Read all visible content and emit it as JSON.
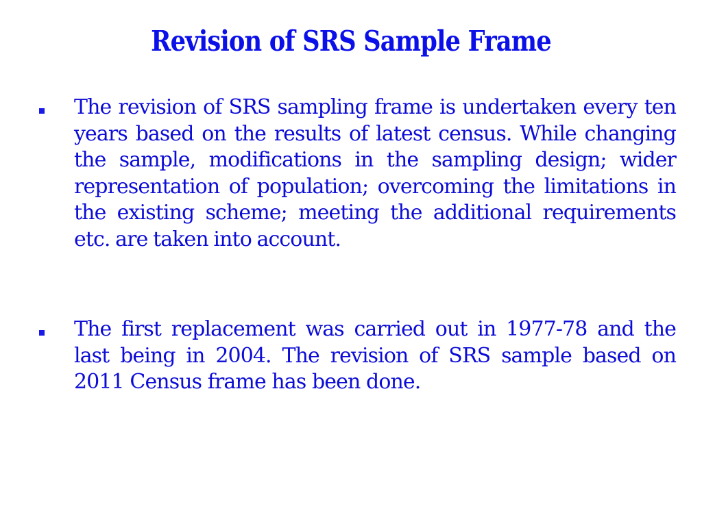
{
  "slide": {
    "title": "Revision of SRS Sample Frame",
    "bullets": [
      {
        "icon": "square-bullet-icon",
        "text": "The revision of SRS sampling frame is undertaken every ten years based on the results of latest census. While changing the sample, modifications in the sampling design; wider representation of population; overcoming the limitations in the existing scheme; meeting the additional requirements etc. are taken into account."
      },
      {
        "icon": "square-bullet-icon",
        "text": "The first replacement was carried out in 1977-78 and the last being in 2004. The revision of SRS sample based on 2011 Census frame has been done."
      }
    ]
  },
  "colors": {
    "title": "#0b10e8",
    "body_text": "#0c0cd6",
    "bullet": "#1a1ae8",
    "background": "#ffffff"
  }
}
